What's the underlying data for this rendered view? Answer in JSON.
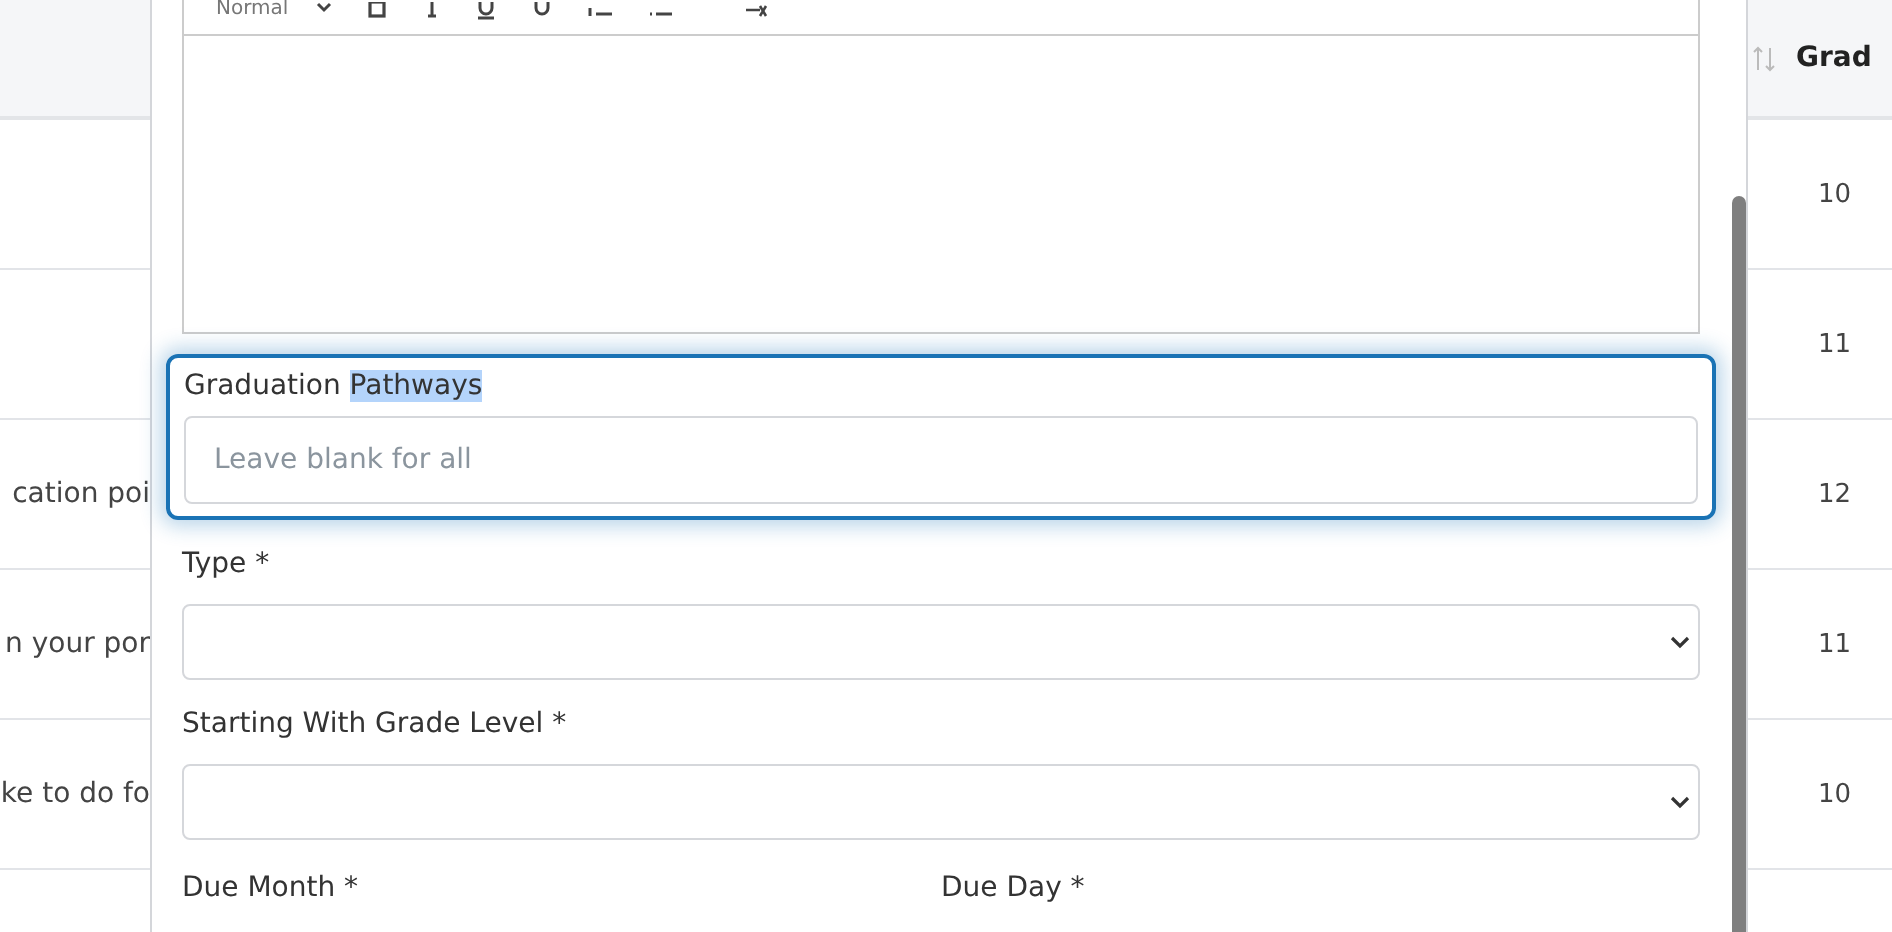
{
  "table": {
    "header": {
      "column_2": "Grad"
    },
    "rows": [
      {
        "column_1": "",
        "grade": "10"
      },
      {
        "column_1": "",
        "grade": "11"
      },
      {
        "column_1": "cation poi",
        "grade": "12"
      },
      {
        "column_1": "n your por",
        "grade": "11"
      },
      {
        "column_1": "ke to do fo",
        "grade": "10"
      }
    ]
  },
  "modal": {
    "editor": {
      "format": "Normal"
    },
    "pathways": {
      "focused": true,
      "label_parts": [
        {
          "text": "Graduation ",
          "selected": false
        },
        {
          "text": "Pathways",
          "selected": true
        }
      ],
      "placeholder": "Leave blank for all"
    },
    "selects": [
      {
        "label": "Type *"
      },
      {
        "label": "Starting With Grade Level *"
      }
    ],
    "date_fields": [
      {
        "label": "Due Month *"
      },
      {
        "label": "Due Day *"
      }
    ]
  }
}
